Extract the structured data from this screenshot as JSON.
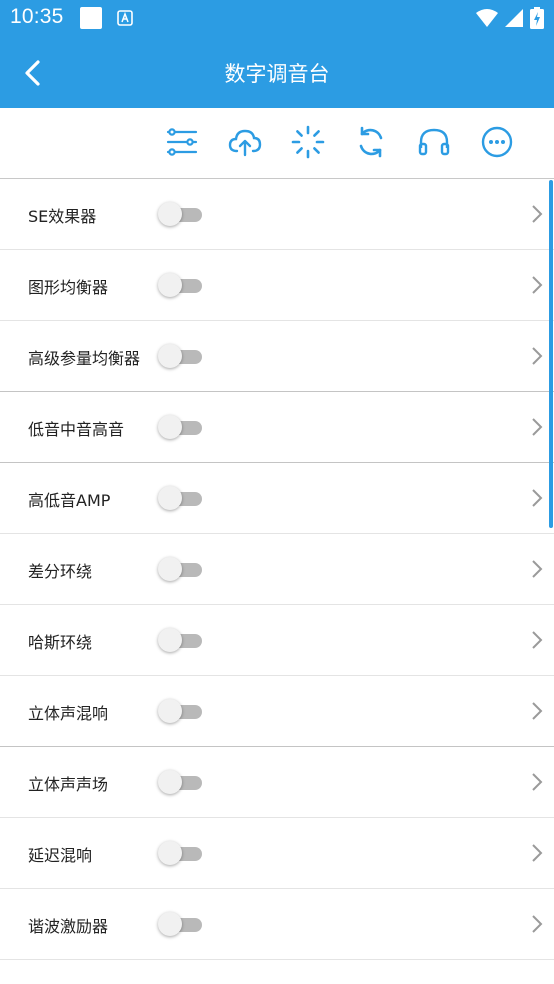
{
  "status": {
    "time": "10:35",
    "icons": [
      "notification-square-icon",
      "app-notification-icon",
      "wifi-icon",
      "signal-icon",
      "battery-charging-icon"
    ]
  },
  "header": {
    "title": "数字调音台",
    "back_icon": "back-arrow-icon"
  },
  "toolbar": {
    "icons": [
      "equalizer-sliders-icon",
      "cloud-upload-icon",
      "loading-spinner-icon",
      "sync-icon",
      "headphones-icon",
      "more-options-icon"
    ],
    "accent": "#2c9ce3"
  },
  "list": {
    "items": [
      {
        "label": "SE效果器",
        "enabled": false
      },
      {
        "label": "图形均衡器",
        "enabled": false
      },
      {
        "label": "高级参量均衡器",
        "enabled": false
      },
      {
        "label": "低音中音高音",
        "enabled": false
      },
      {
        "label": "高低音AMP",
        "enabled": false
      },
      {
        "label": "差分环绕",
        "enabled": false
      },
      {
        "label": "哈斯环绕",
        "enabled": false
      },
      {
        "label": "立体声混响",
        "enabled": false
      },
      {
        "label": "立体声声场",
        "enabled": false
      },
      {
        "label": "延迟混响",
        "enabled": false
      },
      {
        "label": "谐波激励器",
        "enabled": false
      }
    ]
  },
  "colors": {
    "primary": "#2c9ce3",
    "text": "#222222",
    "toggle_off_track": "#b9b9b9",
    "toggle_off_knob": "#f1f1f1"
  }
}
